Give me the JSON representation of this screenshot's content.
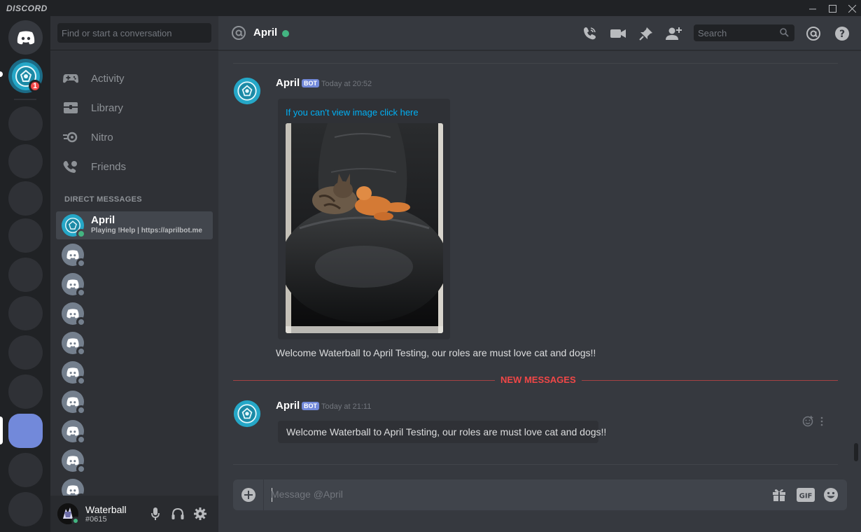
{
  "window": {
    "title": "DISCORD",
    "minimize_icon": "minimize-icon",
    "maximize_icon": "maximize-icon",
    "close_icon": "close-icon"
  },
  "rail": {
    "unread_badge": "1"
  },
  "sidebar": {
    "search_placeholder": "Find or start a conversation",
    "nav": [
      {
        "label": "Activity",
        "icon": "gamepad-icon"
      },
      {
        "label": "Library",
        "icon": "library-icon"
      },
      {
        "label": "Nitro",
        "icon": "nitro-icon"
      },
      {
        "label": "Friends",
        "icon": "friends-icon"
      }
    ],
    "dm_header": "DIRECT MESSAGES",
    "selected_dm": {
      "name": "April",
      "status": "Playing !Help | https://aprilbot.me"
    }
  },
  "user": {
    "name": "Waterball",
    "tag": "#0615"
  },
  "header": {
    "channel_name": "April",
    "search_placeholder": "Search"
  },
  "messages": [
    {
      "author": "April",
      "tag": "BOT",
      "timestamp": "Today at 20:52",
      "embed_link": "If you can't view image click here",
      "text": "Welcome Waterball to April Testing, our roles are must love cat and dogs!!"
    },
    {
      "author": "April",
      "tag": "BOT",
      "timestamp": "Today at 21:11",
      "embed_text": "Welcome Waterball to April Testing, our roles are must love cat and dogs!!"
    }
  ],
  "new_messages_label": "NEW MESSAGES",
  "composer": {
    "placeholder": "Message @April"
  },
  "colors": {
    "blurple": "#7289da",
    "online": "#43b581",
    "danger": "#f04747",
    "link": "#00b0f4"
  }
}
